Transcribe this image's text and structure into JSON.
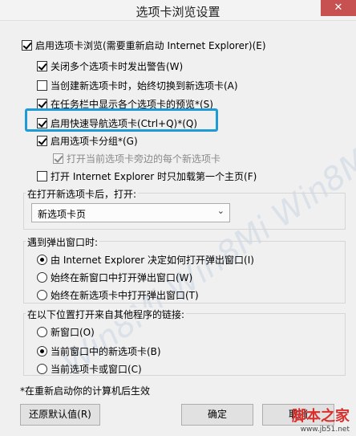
{
  "window": {
    "title": "选项卡浏览设置",
    "close_glyph": "✕"
  },
  "options": {
    "enable_tabs": "启用选项卡浏览(需要重新启动 Internet Explorer)(E)",
    "warn_close": "关闭多个选项卡时发出警告(W)",
    "switch_new_tab": "当创建新选项卡时，始终切换到新选项卡(A)",
    "taskbar_preview": "在任务栏中显示各个选项卡的预览*(S)",
    "quick_tabs": "启用快速导航选项卡(Ctrl+Q)*(Q)",
    "tab_groups": "启用选项卡分组*(G)",
    "open_adjacent": "打开当前选项卡旁边的每个新选项卡",
    "load_first_home": "打开 Internet Explorer 时只加载第一个主页(F)"
  },
  "new_tab": {
    "label": "在打开新选项卡后，打开:",
    "selected": "新选项卡页",
    "arrow_icon": "chevron-down-icon"
  },
  "popup": {
    "label": "遇到弹出窗口时:",
    "items": [
      "由 Internet Explorer 决定如何打开弹出窗口(I)",
      "始终在新窗口中打开弹出窗口(W)",
      "始终在新选项卡中打开弹出窗口(T)"
    ]
  },
  "links": {
    "label": "在以下位置打开来自其他程序的链接:",
    "items": [
      "新窗口(O)",
      "当前窗口中的新选项卡(B)",
      "当前选项卡或窗口(C)"
    ]
  },
  "footer": {
    "note": "*在重新启动你的计算机后生效",
    "restore_defaults": "还原默认值(R)",
    "ok": "确定",
    "cancel": "取消"
  },
  "watermark": {
    "text": "Win8Mi Win8Mi Win8Mi"
  },
  "brand": {
    "name": "脚本之家",
    "url": "www.jb51.net"
  },
  "colors": {
    "highlight": "#1e9bd6",
    "close": "#c75050"
  }
}
